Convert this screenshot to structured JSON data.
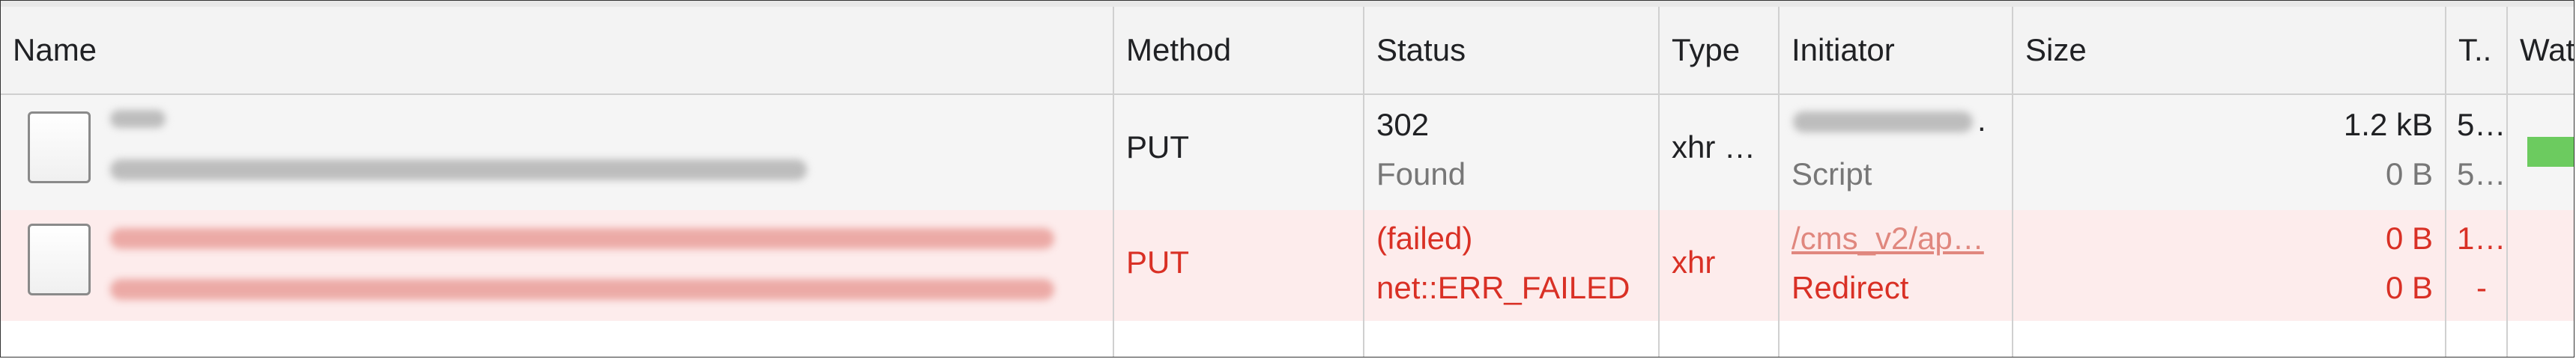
{
  "columns": {
    "name": "Name",
    "method": "Method",
    "status": "Status",
    "type": "Type",
    "initiator": "Initiator",
    "size": "Size",
    "time": "T..",
    "waterfall": "Wat"
  },
  "rows": [
    {
      "method": "PUT",
      "status_code": "302",
      "status_text": "Found",
      "type": "xhr …",
      "initiator_trail": ".",
      "initiator_type": "Script",
      "size_transferred": "1.2 kB",
      "size_resource": "0 B",
      "time_total": "5…",
      "time_latency": "5…"
    },
    {
      "method": "PUT",
      "status_code": "(failed)",
      "status_text": "net::ERR_FAILED",
      "type": "xhr",
      "initiator_link": "/cms_v2/ap…",
      "initiator_type": "Redirect",
      "size_transferred": "0 B",
      "size_resource": "0 B",
      "time_total": "1…",
      "time_latency": "-"
    }
  ],
  "colors": {
    "failed_text": "#d93025",
    "failed_row_bg": "#fdecec",
    "waterfall_bar": "#6ccb5f",
    "header_bg": "#f3f3f3"
  }
}
